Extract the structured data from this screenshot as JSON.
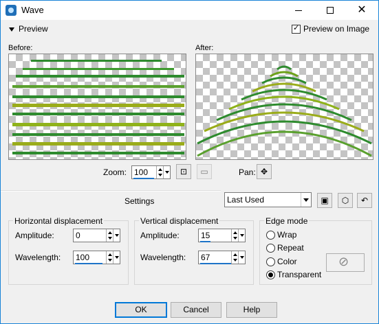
{
  "window": {
    "title": "Wave",
    "minimize": "",
    "maximize": "",
    "close": "✕"
  },
  "preview": {
    "toggle_label": "Preview",
    "preview_on_image": "Preview on Image",
    "before_label": "Before:",
    "after_label": "After:"
  },
  "zoom": {
    "label": "Zoom:",
    "value": "100",
    "pan_label": "Pan:"
  },
  "settings": {
    "label": "Settings",
    "preset": "Last Used"
  },
  "horizontal": {
    "title": "Horizontal displacement",
    "amplitude_label": "Amplitude:",
    "amplitude": "0",
    "wavelength_label": "Wavelength:",
    "wavelength": "100"
  },
  "vertical": {
    "title": "Vertical displacement",
    "amplitude_label": "Amplitude:",
    "amplitude": "15",
    "wavelength_label": "Wavelength:",
    "wavelength": "67"
  },
  "edge": {
    "title": "Edge mode",
    "options": [
      "Wrap",
      "Repeat",
      "Color",
      "Transparent"
    ],
    "selected": "Transparent"
  },
  "buttons": {
    "ok": "OK",
    "cancel": "Cancel",
    "help": "Help"
  },
  "colors": {
    "accent": "#0078d7",
    "stripe_green": "#2e8b2e",
    "stripe_yellow": "#c9b800"
  }
}
